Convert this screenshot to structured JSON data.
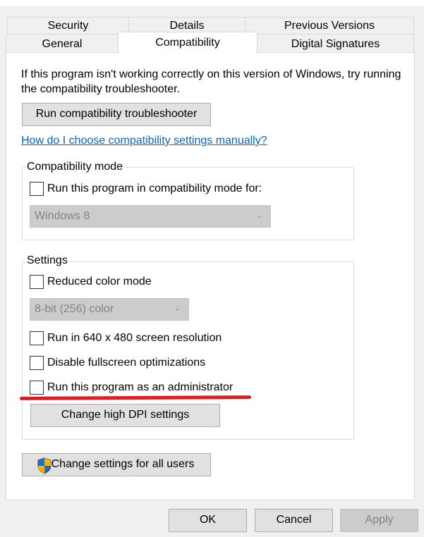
{
  "tabs": {
    "row1": [
      {
        "label": "Security"
      },
      {
        "label": "Details"
      },
      {
        "label": "Previous Versions"
      }
    ],
    "row2": [
      {
        "label": "General"
      },
      {
        "label": "Compatibility",
        "selected": true
      },
      {
        "label": "Digital Signatures"
      }
    ]
  },
  "intro_text": "If this program isn't working correctly on this version of Windows, try running the compatibility troubleshooter.",
  "troubleshooter_button": "Run compatibility troubleshooter",
  "help_link": "How do I choose compatibility settings manually?",
  "compat_mode": {
    "title": "Compatibility mode",
    "checkbox_label": "Run this program in compatibility mode for:",
    "checked": false,
    "dropdown_value": "Windows 8"
  },
  "settings": {
    "title": "Settings",
    "reduced_color": {
      "label": "Reduced color mode",
      "checked": false
    },
    "color_dropdown_value": "8-bit (256) color",
    "res640": {
      "label": "Run in 640 x 480 screen resolution",
      "checked": false
    },
    "fullscreen": {
      "label": "Disable fullscreen optimizations",
      "checked": false
    },
    "admin": {
      "label": "Run this program as an administrator",
      "checked": false
    },
    "dpi_button": "Change high DPI settings"
  },
  "all_users_button": "Change settings for all users",
  "annotation_color": "#e21b23",
  "footer": {
    "ok": "OK",
    "cancel": "Cancel",
    "apply": "Apply"
  }
}
